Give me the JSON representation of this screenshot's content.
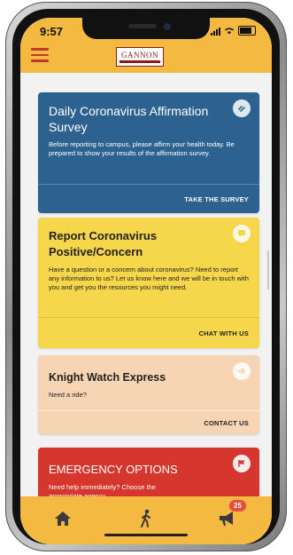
{
  "status_bar": {
    "time": "9:57"
  },
  "header": {
    "logo_text": "GANNON"
  },
  "cards": [
    {
      "title": "Daily Coronavirus Affirmation Survey",
      "body": "Before reporting to campus, please affirm your health today. Be prepared to show your results of the affirmation survey.",
      "action": "TAKE THE SURVEY",
      "icon": "link-icon",
      "color": "#2d6290"
    },
    {
      "title": "Report Coronavirus Positive/Concern",
      "body": "Have a question or a concern about coronavirus? Need to report any information to us? Let us know here and we will be in touch with you and get you the resources you might need.",
      "action": "CHAT WITH US",
      "icon": "chat-icon",
      "color": "#f6d64a"
    },
    {
      "title": "Knight Watch Express",
      "body": "Need a ride?",
      "action": "CONTACT US",
      "icon": "arrow-icon",
      "color": "#f7d4b3"
    },
    {
      "title": "EMERGENCY OPTIONS",
      "body": "Need help immediately? Choose the appropriate agency.",
      "icon": "flag-icon",
      "color": "#d5362d"
    }
  ],
  "tabbar": {
    "tabs": [
      {
        "icon": "home-icon"
      },
      {
        "icon": "walking-person-icon"
      },
      {
        "icon": "megaphone-icon",
        "badge": "25"
      }
    ]
  },
  "colors": {
    "accent": "#f3b941",
    "menu": "#c0392b",
    "badge": "#e74c3c"
  }
}
